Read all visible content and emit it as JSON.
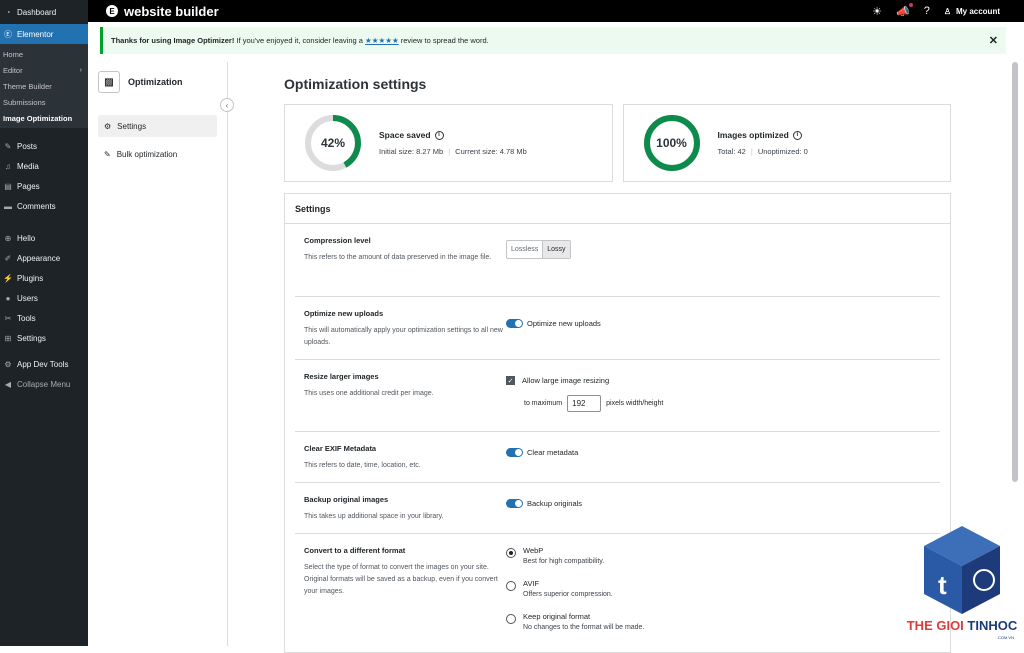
{
  "sidebar": {
    "items_top": [
      {
        "label": "Dashboard",
        "icon": "dashboard-icon"
      }
    ],
    "elementor": {
      "label": "Elementor",
      "icon": "elementor-icon"
    },
    "submenu": [
      {
        "label": "Home"
      },
      {
        "label": "Editor",
        "arrow": "›"
      },
      {
        "label": "Theme Builder"
      },
      {
        "label": "Submissions"
      },
      {
        "label": "Image Optimization"
      }
    ],
    "items": [
      {
        "label": "Posts",
        "icon": "pin-icon"
      },
      {
        "label": "Media",
        "icon": "media-icon"
      },
      {
        "label": "Pages",
        "icon": "pages-icon"
      },
      {
        "label": "Comments",
        "icon": "comments-icon"
      },
      {
        "label": "Hello",
        "icon": "hello-icon"
      },
      {
        "label": "Appearance",
        "icon": "brush-icon"
      },
      {
        "label": "Plugins",
        "icon": "plugin-icon"
      },
      {
        "label": "Users",
        "icon": "users-icon"
      },
      {
        "label": "Tools",
        "icon": "tools-icon"
      },
      {
        "label": "Settings",
        "icon": "settings-icon"
      },
      {
        "label": "App Dev Tools",
        "icon": "app-dev-icon"
      },
      {
        "label": "Collapse Menu",
        "icon": "collapse-icon"
      }
    ]
  },
  "topbar": {
    "logo_letter": "E",
    "site_title": "website builder",
    "account": "My account"
  },
  "notice": {
    "bold": "Thanks for using Image Optimizer!",
    "text": " If you've enjoyed it, consider leaving a ",
    "stars": "★★★★★",
    "text_end": " review to spread the word.",
    "close": "✕"
  },
  "subpanel": {
    "title": "Optimization",
    "items": [
      {
        "label": "Settings"
      },
      {
        "label": "Bulk optimization"
      }
    ]
  },
  "main": {
    "title": "Optimization settings",
    "space_saved": {
      "percent": 42,
      "percent_label": "42%",
      "title": "Space saved",
      "initial": "Initial size: 8.27 Mb",
      "current": "Current size: 4.78 Mb",
      "color": "#0e8a4d"
    },
    "images_optimized": {
      "percent": 100,
      "percent_label": "100%",
      "title": "Images optimized",
      "total": "Total: 42",
      "unoptimized": "Unoptimized: 0",
      "color": "#0e8a4d"
    }
  },
  "settings": {
    "title": "Settings",
    "compression": {
      "title": "Compression level",
      "desc": "This refers to the amount of data preserved in the image file.",
      "options": [
        "Lossless",
        "Lossy"
      ],
      "selected": "Lossy"
    },
    "optimize_uploads": {
      "title": "Optimize new uploads",
      "desc": "This will automatically apply your optimization settings to all new uploads.",
      "toggle_label": "Optimize new uploads",
      "on": true
    },
    "resize": {
      "title": "Resize larger images",
      "desc": "This uses one additional credit per image.",
      "checkbox_label": "Allow large image resizing",
      "checked": true,
      "max_prefix": "to maximum",
      "max_value": "192",
      "max_suffix": "pixels width/height"
    },
    "exif": {
      "title": "Clear EXIF Metadata",
      "desc": "This refers to date, time, location, etc.",
      "toggle_label": "Clear metadata",
      "on": true
    },
    "backup": {
      "title": "Backup original images",
      "desc": "This takes up additional space in your library.",
      "toggle_label": "Backup originals",
      "on": true
    },
    "convert": {
      "title": "Convert to a different format",
      "desc": "Select the type of format to convert the images on your site. Original formats will be saved as a backup, even if you convert your images.",
      "options": [
        {
          "label": "WebP",
          "desc": "Best for high compatibility.",
          "selected": true
        },
        {
          "label": "AVIF",
          "desc": "Offers superior compression.",
          "selected": false
        },
        {
          "label": "Keep original format",
          "desc": "No changes to the format will be made.",
          "selected": false
        }
      ]
    }
  },
  "watermark": {
    "text_red": "THE GIOI ",
    "text_blue": "TINHOC",
    "sub": ".COM.VN",
    "letter": "t"
  }
}
